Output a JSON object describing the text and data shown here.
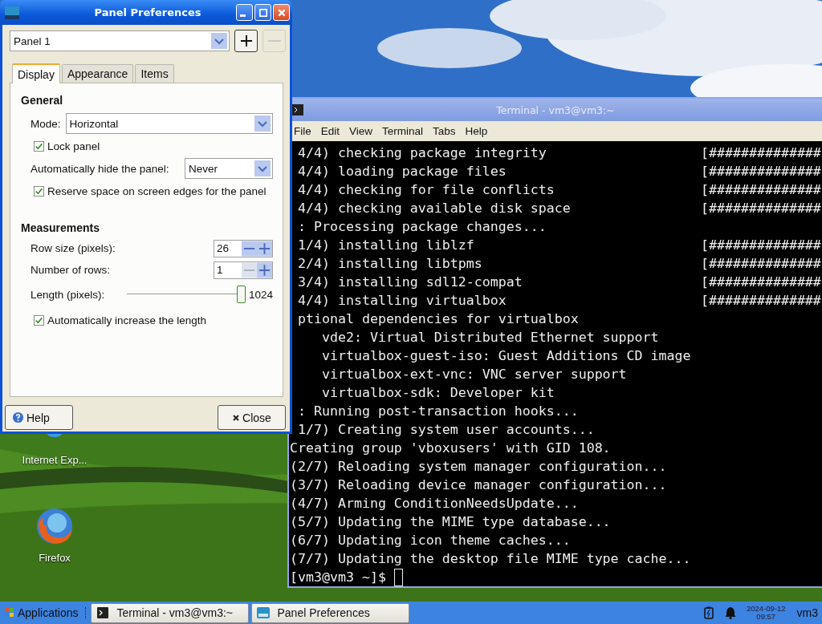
{
  "desktop_icons": [
    {
      "kind": "globe",
      "label": "Internet Exp..."
    },
    {
      "kind": "fox",
      "label": "Firefox"
    }
  ],
  "terminal": {
    "title": "Terminal - vm3@vm3:~",
    "menu": [
      "File",
      "Edit",
      "View",
      "Terminal",
      "Tabs",
      "Help"
    ],
    "lines": [
      {
        "text": " 4/4) checking package integrity",
        "progress": "[##############"
      },
      {
        "text": " 4/4) loading package files",
        "progress": "[##############"
      },
      {
        "text": " 4/4) checking for file conflicts",
        "progress": "[##############"
      },
      {
        "text": " 4/4) checking available disk space",
        "progress": "[##############"
      },
      {
        "text": " : Processing package changes..."
      },
      {
        "text": " 1/4) installing liblzf",
        "progress": "[##############"
      },
      {
        "text": " 2/4) installing libtpms",
        "progress": "[##############"
      },
      {
        "text": " 3/4) installing sdl12-compat",
        "progress": "[##############"
      },
      {
        "text": " 4/4) installing virtualbox",
        "progress": "[##############"
      },
      {
        "text": " ptional dependencies for virtualbox"
      },
      {
        "text": "    vde2: Virtual Distributed Ethernet support"
      },
      {
        "text": "    virtualbox-guest-iso: Guest Additions CD image"
      },
      {
        "text": "    virtualbox-ext-vnc: VNC server support"
      },
      {
        "text": "    virtualbox-sdk: Developer kit"
      },
      {
        "text": " : Running post-transaction hooks..."
      },
      {
        "text": " 1/7) Creating system user accounts..."
      },
      {
        "text": "Creating group 'vboxusers' with GID 108."
      },
      {
        "text": "(2/7) Reloading system manager configuration..."
      },
      {
        "text": "(3/7) Reloading device manager configuration..."
      },
      {
        "text": "(4/7) Arming ConditionNeedsUpdate..."
      },
      {
        "text": "(5/7) Updating the MIME type database..."
      },
      {
        "text": "(6/7) Updating icon theme caches..."
      },
      {
        "text": "(7/7) Updating the desktop file MIME type cache..."
      }
    ],
    "prompt": "[vm3@vm3 ~]$"
  },
  "dialog": {
    "title": "Panel Preferences",
    "panel_select": "Panel 1",
    "panel_buttons": [
      {
        "kind": "add",
        "disabled": false
      },
      {
        "kind": "remove",
        "disabled": true
      }
    ],
    "tabs": [
      {
        "label": "Display",
        "selected": true
      },
      {
        "label": "Appearance",
        "selected": false
      },
      {
        "label": "Items",
        "selected": false
      }
    ],
    "general": {
      "heading": "General",
      "mode": {
        "label": "Mode:",
        "value": "Horizontal"
      },
      "lock_panel": {
        "label": "Lock panel",
        "checked": true
      },
      "autohide": {
        "label": "Automatically hide the panel:",
        "value": "Never"
      },
      "reserve_space": {
        "label": "Reserve space on screen edges for the panel",
        "checked": true
      }
    },
    "measurements": {
      "heading": "Measurements",
      "spinners": [
        {
          "label": "Row size (pixels):",
          "value": "26",
          "decrease_disabled": false
        },
        {
          "label": "Number of rows:",
          "value": "1",
          "decrease_disabled": true
        }
      ],
      "length": {
        "label": "Length (pixels):",
        "level": 1,
        "reading": "1024"
      },
      "auto_increase": {
        "label": "Automatically increase the length",
        "checked": true
      }
    },
    "help_button": "Help",
    "close_button": "Close"
  },
  "taskbar": {
    "menu_label": "Applications",
    "tasks": [
      {
        "kind": "terminal",
        "label": "Terminal - vm3@vm3:~"
      },
      {
        "kind": "panel",
        "label": "Panel Preferences"
      }
    ],
    "date": "2024-09-12",
    "time": "09:57",
    "user": "vm3"
  }
}
